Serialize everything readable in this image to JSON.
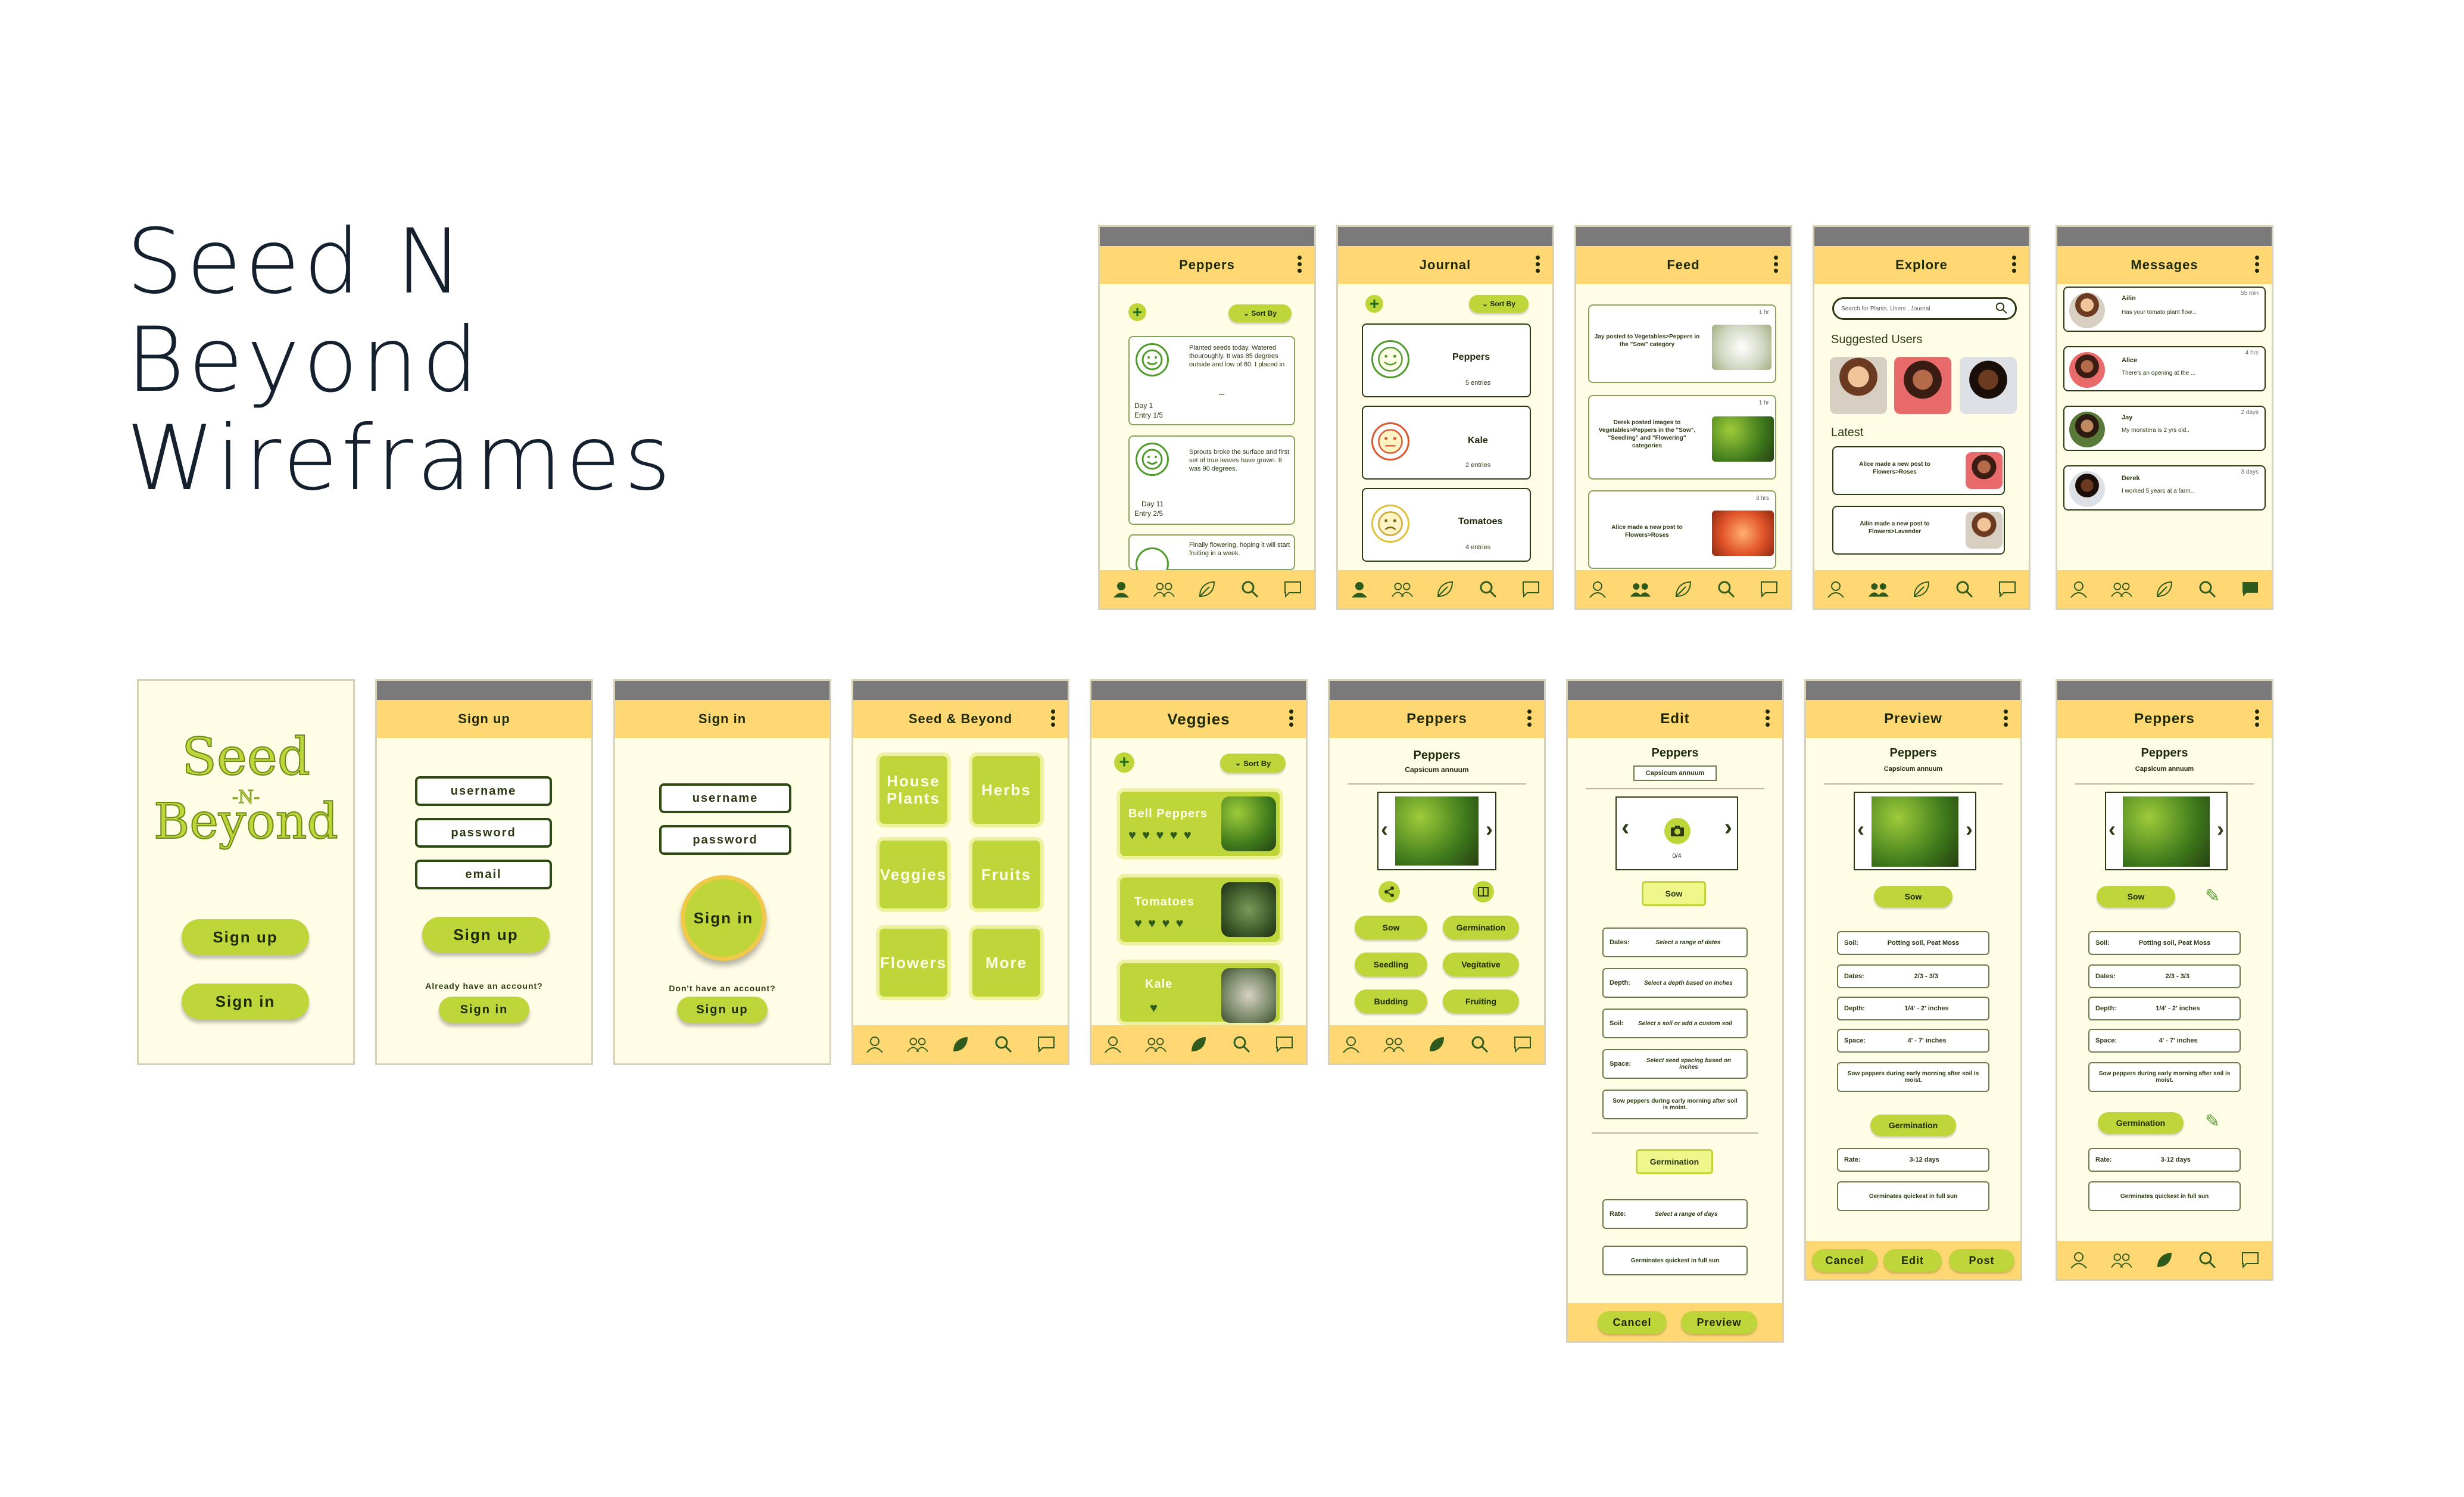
{
  "page_title": [
    "Seed N",
    "Beyond",
    "Wireframes"
  ],
  "nav_icons": [
    "profile-icon",
    "friends-icon",
    "leaf-icon",
    "search-icon",
    "chat-icon"
  ],
  "colors": {
    "header": "#ffd873",
    "screen": "#fffde6",
    "accent": "#bfd63a",
    "topbar": "#7a7a7a"
  },
  "top_row": {
    "peppers_journal": {
      "title": "Peppers",
      "sort_label": "Sort By",
      "entries": [
        {
          "text": "Planted seeds today. Watered thouroughly. It was 85 degrees outside and low of 60. I placed in",
          "day": "Day 1",
          "entry": "Entry 1/5",
          "more": "..."
        },
        {
          "text": "Sprouts broke the surface and first set of true leaves have grown. It was 90 degrees.",
          "day": "Day 11",
          "entry": "Entry 2/5"
        },
        {
          "text": "Finally flowering, hoping it will start fruiting in a week."
        }
      ]
    },
    "journal": {
      "title": "Journal",
      "sort_label": "Sort By",
      "items": [
        {
          "name": "Peppers",
          "count": "5 entries"
        },
        {
          "name": "Kale",
          "count": "2 entries"
        },
        {
          "name": "Tomatoes",
          "count": "4 entries"
        }
      ]
    },
    "feed": {
      "title": "Feed",
      "posts": [
        {
          "time": "1 hr",
          "text": "Jay posted to Vegetables>Peppers in the \"Sow\" category"
        },
        {
          "time": "1 hr",
          "text": "Derek posted images to Vegetables>Peppers in the \"Sow\", \"Seedling\" and \"Flowering\" categories"
        },
        {
          "time": "3 hrs",
          "text": "Alice made a new post to Flowers>Roses"
        }
      ]
    },
    "explore": {
      "title": "Explore",
      "search_placeholder": "Search for Plants, Users , Journal",
      "suggested_label": "Suggested Users",
      "latest_label": "Latest",
      "latest": [
        {
          "text": "Alice made a new post to Flowers>Roses"
        },
        {
          "text": "Ailin made a new post to Flowers>Lavender"
        }
      ]
    },
    "messages": {
      "title": "Messages",
      "threads": [
        {
          "name": "Ailin",
          "time": "55 min",
          "preview": "Has your tomato plant flow..."
        },
        {
          "name": "Alice",
          "time": "4 hrs",
          "preview": "There's an opening at the ..."
        },
        {
          "name": "Jay",
          "time": "2 days",
          "preview": "My monstera is 2 yrs old.."
        },
        {
          "name": "Derek",
          "time": "3 days",
          "preview": "I worked 5 years at a farm.."
        }
      ]
    }
  },
  "bottom_row": {
    "splash": {
      "logo_line1": "Seed",
      "logo_line2": "-N-",
      "logo_line3": "Beyond",
      "signup": "Sign up",
      "signin": "Sign in"
    },
    "signup": {
      "title": "Sign up",
      "username": "username",
      "password": "password",
      "email": "email",
      "button": "Sign up",
      "already": "Already have an account?",
      "signin": "Sign in"
    },
    "signin": {
      "title": "Sign in",
      "username": "username",
      "password": "password",
      "button": "Sign in",
      "no_account": "Don't  have an account?",
      "signup": "Sign up"
    },
    "home": {
      "title": "Seed & Beyond",
      "tiles": [
        "House Plants",
        "Herbs",
        "Veggies",
        "Fruits",
        "Flowers",
        "More"
      ]
    },
    "veggies": {
      "title": "Veggies",
      "sort_label": "Sort By",
      "items": [
        {
          "name": "Bell Peppers",
          "hearts": "♥ ♥ ♥ ♥ ♥"
        },
        {
          "name": "Tomatoes",
          "hearts": "♥ ♥ ♥ ♥"
        },
        {
          "name": "Kale",
          "hearts": "♥"
        }
      ]
    },
    "peppers_detail": {
      "title": "Peppers",
      "name": "Peppers",
      "latin": "Capsicum annuum",
      "stages": [
        "Sow",
        "Germination",
        "Seedling",
        "Vegitative",
        "Budding",
        "Fruiting"
      ]
    },
    "edit": {
      "title": "Edit",
      "name": "Peppers",
      "latin": "Capsicum annuum",
      "photo_count": "0/4",
      "sow_label": "Sow",
      "rows": [
        {
          "label": "Dates:",
          "value": "Select a range of dates"
        },
        {
          "label": "Depth:",
          "value": "Select a depth based on inches"
        },
        {
          "label": "Soil:",
          "value": "Select a soil or add a custom soil"
        },
        {
          "label": "Space:",
          "value": "Select seed spacing based on inches"
        },
        {
          "label": "",
          "value": "Sow peppers during early morning after soil is moist."
        }
      ],
      "germ_label": "Germination",
      "germ_rows": [
        {
          "label": "Rate:",
          "value": "Select a range of days"
        },
        {
          "label": "",
          "value": "Germinates quickest in full sun"
        }
      ],
      "cancel": "Cancel",
      "preview": "Preview"
    },
    "preview": {
      "title": "Preview",
      "name": "Peppers",
      "latin": "Capsicum annuum",
      "sow_label": "Sow",
      "rows": [
        {
          "label": "Soil:",
          "value": "Potting soil, Peat Moss"
        },
        {
          "label": "Dates:",
          "value": "2/3 - 3/3"
        },
        {
          "label": "Depth:",
          "value": "1/4' - 2' inches"
        },
        {
          "label": "Space:",
          "value": "4' - 7' inches"
        },
        {
          "label": "",
          "value": "Sow peppers during early morning after soil is moist."
        }
      ],
      "germ_label": "Germination",
      "germ_rows": [
        {
          "label": "Rate:",
          "value": "3-12 days"
        },
        {
          "label": "",
          "value": "Germinates quickest in full sun"
        }
      ],
      "cancel": "Cancel",
      "edit": "Edit",
      "post": "Post"
    },
    "final": {
      "title": "Peppers",
      "name": "Peppers",
      "latin": "Capsicum annuum",
      "sow_label": "Sow",
      "rows": [
        {
          "label": "Soil:",
          "value": "Potting soil, Peat Moss"
        },
        {
          "label": "Dates:",
          "value": "2/3 - 3/3"
        },
        {
          "label": "Depth:",
          "value": "1/4' - 2' inches"
        },
        {
          "label": "Space:",
          "value": "4' - 7' inches"
        },
        {
          "label": "",
          "value": "Sow peppers during early morning after soil is moist."
        }
      ],
      "germ_label": "Germination",
      "germ_rows": [
        {
          "label": "Rate:",
          "value": "3-12 days"
        },
        {
          "label": "",
          "value": "Germinates quickest in full sun"
        }
      ]
    }
  }
}
